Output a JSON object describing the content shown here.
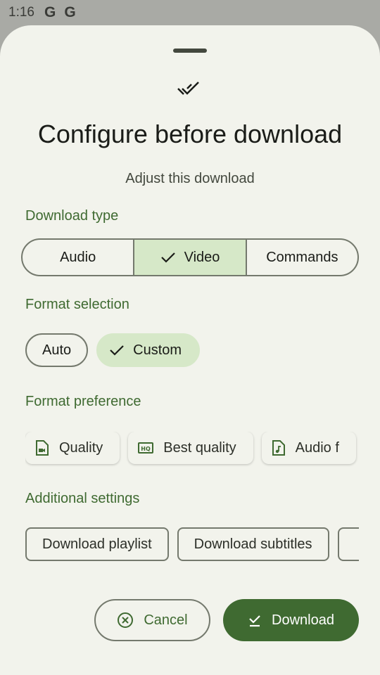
{
  "status_bar": {
    "time": "1:16",
    "notification_icons": [
      "G",
      "G"
    ]
  },
  "dialog": {
    "title": "Configure before download",
    "subtitle": "Adjust this download",
    "download_type": {
      "label": "Download type",
      "options": [
        "Audio",
        "Video",
        "Commands"
      ],
      "selected": "Video"
    },
    "format_selection": {
      "label": "Format selection",
      "options": [
        "Auto",
        "Custom"
      ],
      "selected": "Custom"
    },
    "format_preference": {
      "label": "Format preference",
      "chips": [
        {
          "icon": "video-file-icon",
          "label": "Quality"
        },
        {
          "icon": "hq-icon",
          "label": "Best quality"
        },
        {
          "icon": "audio-file-icon",
          "label": "Audio f"
        }
      ]
    },
    "additional_settings": {
      "label": "Additional settings",
      "chips": [
        "Download playlist",
        "Download subtitles"
      ]
    },
    "buttons": {
      "cancel": "Cancel",
      "download": "Download"
    }
  },
  "colors": {
    "accent": "#3f6a31",
    "selected_bg": "#d6e8c8",
    "surface": "#f2f3ec",
    "outline": "#74796d"
  }
}
